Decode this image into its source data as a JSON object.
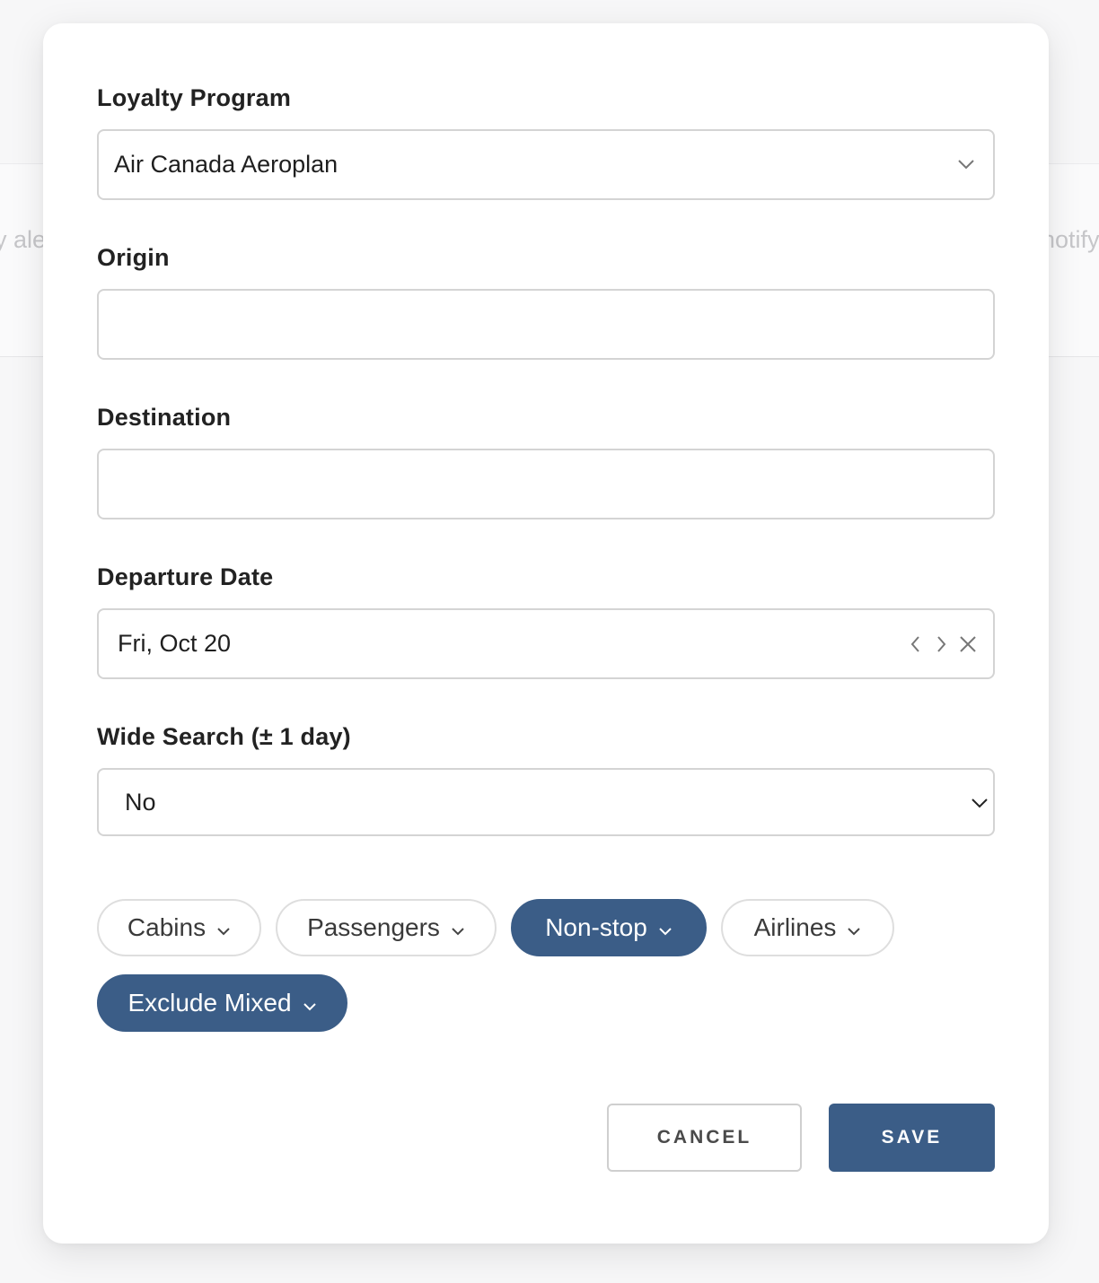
{
  "background": {
    "left_partial_text": "y ale",
    "right_partial_text": "notify"
  },
  "form": {
    "loyalty_program": {
      "label": "Loyalty Program",
      "value": "Air Canada Aeroplan",
      "icon": "chevron-down-icon"
    },
    "origin": {
      "label": "Origin",
      "value": "",
      "placeholder": ""
    },
    "destination": {
      "label": "Destination",
      "value": "",
      "placeholder": ""
    },
    "departure_date": {
      "label": "Departure Date",
      "value": "Fri, Oct 20",
      "icons": [
        "chevron-left-icon",
        "chevron-right-icon",
        "close-icon"
      ]
    },
    "wide_search": {
      "label": "Wide Search (± 1 day)",
      "value": "No",
      "icon": "chevron-down-icon"
    }
  },
  "filters": [
    {
      "label": "Cabins",
      "active": false
    },
    {
      "label": "Passengers",
      "active": false
    },
    {
      "label": "Non-stop",
      "active": true
    },
    {
      "label": "Airlines",
      "active": false
    },
    {
      "label": "Exclude Mixed",
      "active": true
    }
  ],
  "actions": {
    "cancel_label": "CANCEL",
    "save_label": "SAVE"
  },
  "colors": {
    "accent": "#3b5d87",
    "border": "#d4d4d4",
    "label_text": "#222222"
  }
}
